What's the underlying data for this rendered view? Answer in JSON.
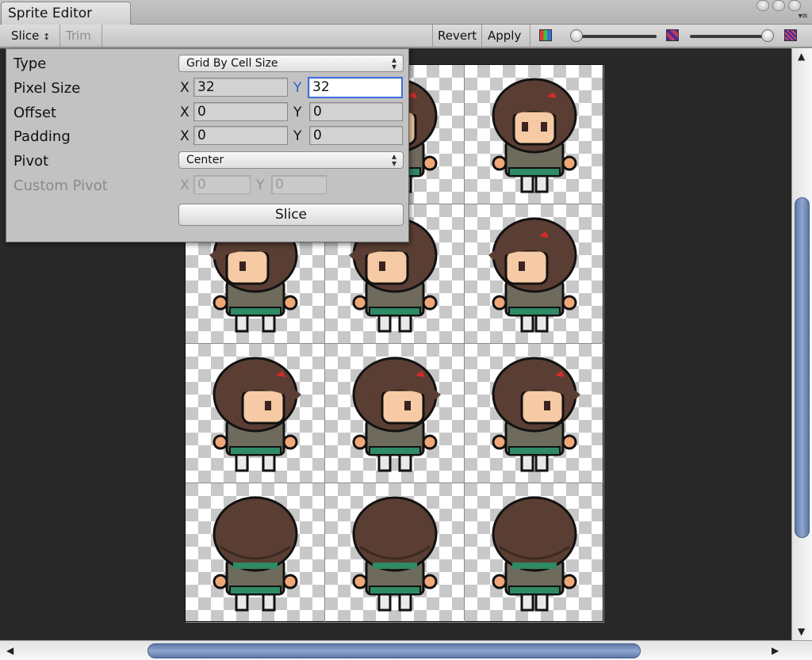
{
  "tab": {
    "title": "Sprite Editor"
  },
  "toolbar": {
    "slice_label": "Slice",
    "slice_arrows": "↕",
    "trim_label": "Trim",
    "revert_label": "Revert",
    "apply_label": "Apply"
  },
  "popup": {
    "type_label": "Type",
    "type_value": "Grid By Cell Size",
    "pixel_size_label": "Pixel Size",
    "pixel_size_x": "32",
    "pixel_size_y": "32",
    "offset_label": "Offset",
    "offset_x": "0",
    "offset_y": "0",
    "padding_label": "Padding",
    "padding_x": "0",
    "padding_y": "0",
    "pivot_label": "Pivot",
    "pivot_value": "Center",
    "custom_pivot_label": "Custom Pivot",
    "custom_pivot_x": "0",
    "custom_pivot_y": "0",
    "slice_button_label": "Slice",
    "axis_x": "X",
    "axis_y": "Y",
    "dropdown_arrows": "▴▾"
  },
  "sprite_sheet": {
    "columns": 3,
    "rows": 4,
    "row_facings": [
      "front",
      "left",
      "right",
      "back"
    ]
  },
  "colors": {
    "accent_focus": "#3d6ee0",
    "scroll_thumb": "#6f88b5",
    "canvas_bg": "#282828",
    "panel_bg": "#c2c2c2"
  }
}
